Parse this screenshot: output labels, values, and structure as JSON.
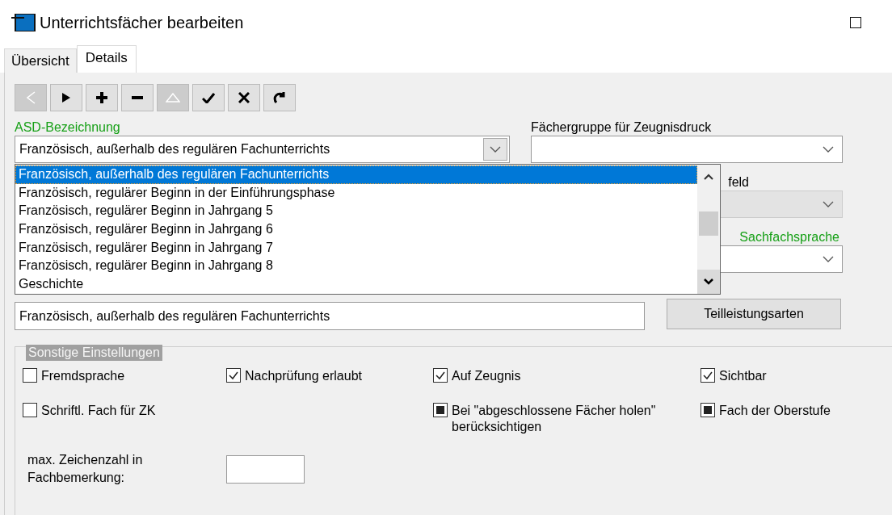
{
  "window": {
    "title": "Unterrichtsfächer bearbeiten"
  },
  "tabs": [
    {
      "label": "Übersicht",
      "selected": false
    },
    {
      "label": "Details",
      "selected": true
    }
  ],
  "toolbar": [
    {
      "kind": "prev",
      "disabled": true
    },
    {
      "kind": "next",
      "disabled": false
    },
    {
      "kind": "add",
      "disabled": false
    },
    {
      "kind": "remove",
      "disabled": false
    },
    {
      "kind": "up",
      "disabled": true
    },
    {
      "kind": "save",
      "disabled": false
    },
    {
      "kind": "cancel",
      "disabled": false
    },
    {
      "kind": "refresh",
      "disabled": false
    }
  ],
  "asd": {
    "label": "ASD-Bezeichnung",
    "required": true,
    "value": "Französisch, außerhalb des regulären Fachunterrichts",
    "expanded": true,
    "options": [
      {
        "label": "Französisch, außerhalb des regulären Fachunterrichts",
        "selected": true
      },
      {
        "label": "Französisch, regulärer Beginn in der Einführungsphase",
        "selected": false
      },
      {
        "label": "Französisch, regulärer Beginn in Jahrgang 5",
        "selected": false
      },
      {
        "label": "Französisch, regulärer Beginn in Jahrgang 6",
        "selected": false
      },
      {
        "label": "Französisch, regulärer Beginn in Jahrgang 7",
        "selected": false
      },
      {
        "label": "Französisch, regulärer Beginn in Jahrgang 8",
        "selected": false
      },
      {
        "label": "Geschichte",
        "selected": false
      }
    ]
  },
  "right_fields": [
    {
      "label": "Fächergruppe für Zeugnisdruck",
      "required": false,
      "disabled": false
    },
    {
      "label": "feld",
      "required": false,
      "disabled": true
    },
    {
      "label": "Sachfachsprache",
      "required": true,
      "disabled": false
    }
  ],
  "ueberweisung": {
    "value": "Französisch, außerhalb des regulären Fachunterrichts"
  },
  "teilleistungsarten_button": "Teilleistungsarten",
  "settings": {
    "title": "Sonstige Einstellungen",
    "columns": [
      [
        {
          "label": "Fremdsprache",
          "checked": false,
          "mixed": false
        },
        {
          "label": "Schriftl. Fach für ZK",
          "checked": false,
          "mixed": false
        }
      ],
      [
        {
          "label": "Nachprüfung erlaubt",
          "checked": true,
          "mixed": false
        }
      ],
      [
        {
          "label": "Auf Zeugnis",
          "checked": true,
          "mixed": false
        },
        {
          "label": "Bei \"abgeschlossene Fächer holen\" berücksichtigen",
          "checked": false,
          "mixed": true
        }
      ],
      [
        {
          "label": "Sichtbar",
          "checked": true,
          "mixed": false
        },
        {
          "label": "Fach der Oberstufe",
          "checked": false,
          "mixed": true
        }
      ]
    ],
    "max_chars_label": "max. Zeichenzahl in Fachbemerkung:"
  }
}
